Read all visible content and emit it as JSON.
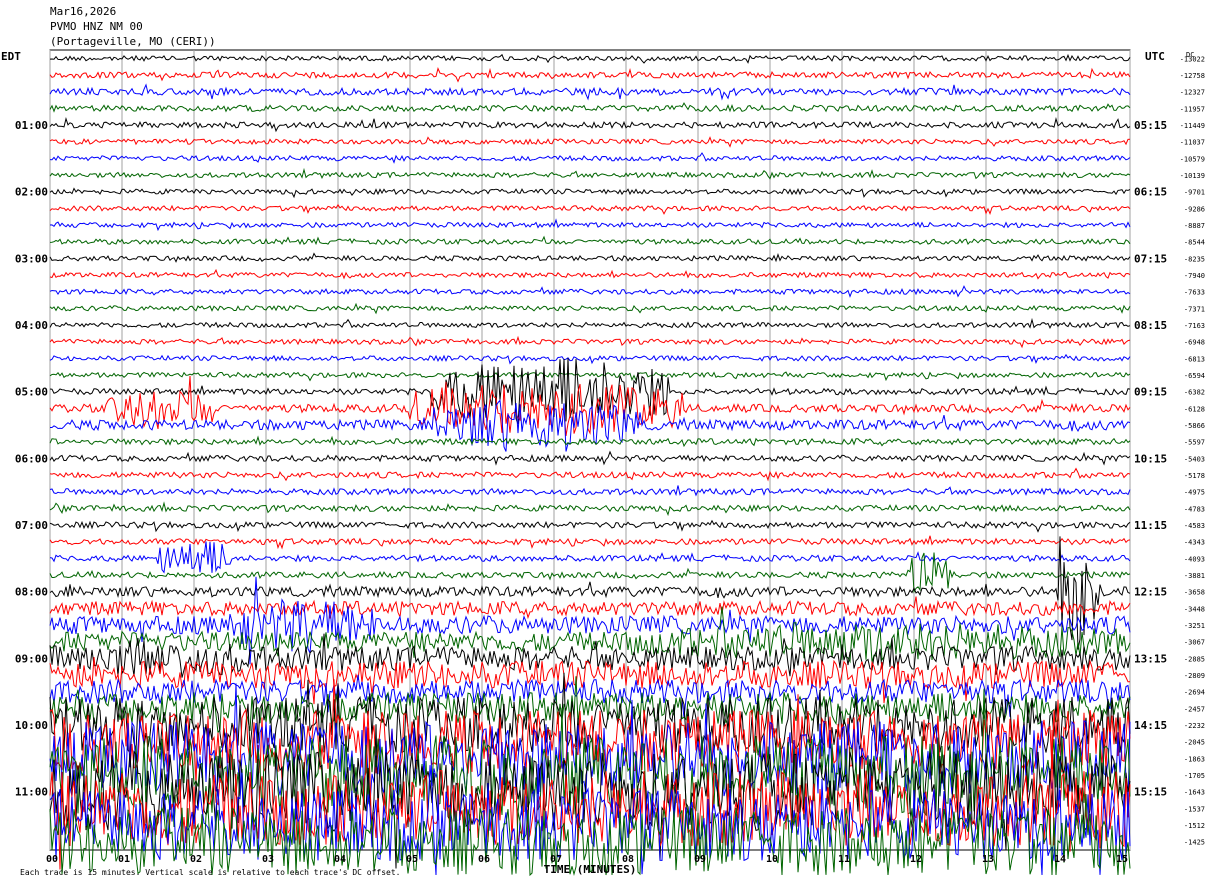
{
  "header": {
    "date": "Mar16,2026",
    "station": "PVMO HNZ NM 00",
    "location": "(Portageville, MO (CERI))"
  },
  "colors": {
    "trace_cycle": [
      "#000000",
      "#ff0000",
      "#0000ff",
      "#006400"
    ],
    "grid": "#a0a0a0",
    "background": "#ffffff"
  },
  "chart_data": {
    "type": "line",
    "kind": "helicorder",
    "left_axis_label": "EDT",
    "right_axis_label": "UTC",
    "x_axis_title": "TIME (MINUTES)",
    "x_ticks": [
      "00",
      "01",
      "02",
      "03",
      "04",
      "05",
      "06",
      "07",
      "08",
      "09",
      "10",
      "11",
      "12",
      "13",
      "14",
      "15"
    ],
    "xlim": [
      0,
      15
    ],
    "grid": true,
    "rows": 48,
    "edt_hour_labels": [
      "01:00",
      "02:00",
      "03:00",
      "04:00",
      "05:00",
      "06:00",
      "07:00",
      "08:00",
      "09:00",
      "10:00",
      "11:00"
    ],
    "utc_hour_labels": [
      "05:15",
      "06:15",
      "07:15",
      "08:15",
      "09:15",
      "10:15",
      "11:15",
      "12:15",
      "13:15",
      "14:15",
      "15:15"
    ],
    "hour_label_start_row": 4,
    "rows_per_hour": 4,
    "row_dc_offsets": [
      -13022,
      -12758,
      -12327,
      -11957,
      -11449,
      -11037,
      -10579,
      -10139,
      -9701,
      -9286,
      -8887,
      -8544,
      -8235,
      -7940,
      -7633,
      -7371,
      -7163,
      -6948,
      -6813,
      -6594,
      -6382,
      -6128,
      -5866,
      -5597,
      -5403,
      -5178,
      -4975,
      -4783,
      -4583,
      -4343,
      -4093,
      -3881,
      -3658,
      -3448,
      -3251,
      -3067,
      -2885,
      -2809,
      -2694,
      -2457,
      -2232,
      -2045,
      -1863,
      -1705,
      -1643,
      -1537,
      -1512,
      -1425
    ],
    "dc_header": "DC",
    "trace_amplitude": [
      2.5,
      3,
      3.5,
      3,
      3,
      2.5,
      2.5,
      2.5,
      2.5,
      2.5,
      2.5,
      2.5,
      2.5,
      2.5,
      2.5,
      2.5,
      2.5,
      2.5,
      2.5,
      2.5,
      3,
      4,
      5,
      3,
      3,
      3,
      3,
      3,
      3,
      3,
      3,
      3,
      5,
      7,
      9,
      10,
      12,
      14,
      12,
      16,
      28,
      32,
      38,
      40,
      40,
      38,
      36,
      34
    ],
    "events": [
      {
        "row": 20,
        "start_min": 5.3,
        "end_min": 8.6,
        "amplitude": 38
      },
      {
        "row": 21,
        "start_min": 0.8,
        "end_min": 2.3,
        "amplitude": 22
      },
      {
        "row": 21,
        "start_min": 5.0,
        "end_min": 8.8,
        "amplitude": 30
      },
      {
        "row": 22,
        "start_min": 5.3,
        "end_min": 8.2,
        "amplitude": 30
      },
      {
        "row": 30,
        "start_min": 1.5,
        "end_min": 2.5,
        "amplitude": 22
      },
      {
        "row": 31,
        "start_min": 11.9,
        "end_min": 12.5,
        "amplitude": 26
      },
      {
        "row": 32,
        "start_min": 14.0,
        "end_min": 14.6,
        "amplitude": 60
      },
      {
        "row": 34,
        "start_min": 2.5,
        "end_min": 4.5,
        "amplitude": 30
      },
      {
        "row": 35,
        "start_min": 8.0,
        "end_min": 15.0,
        "amplitude": 22
      },
      {
        "row": 36,
        "start_min": 0.0,
        "end_min": 3.0,
        "amplitude": 22
      }
    ],
    "footer_text": "Each trace is 15 minutes. Vertical scale is relative to each trace's DC offset."
  }
}
